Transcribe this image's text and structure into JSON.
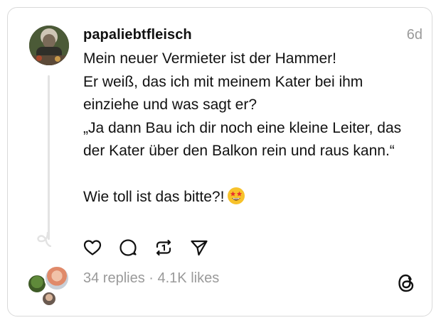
{
  "post": {
    "username": "papaliebtfleisch",
    "timestamp": "6d",
    "lines": [
      "Mein neuer Vermieter ist der Hammer!",
      "Er weiß, das ich mit meinem Kater bei ihm einziehe und was sagt er?",
      "„Ja dann Bau ich dir noch eine kleine Leiter, das der Kater über den Balkon rein und raus kann.“"
    ],
    "closing_line": "Wie toll ist das bitte?!",
    "closing_emoji": "star-struck-emoji"
  },
  "actions": {
    "like_icon": "heart-icon",
    "reply_icon": "comment-icon",
    "repost_icon": "repost-icon",
    "share_icon": "send-icon"
  },
  "stats": {
    "text": "34 replies · 4.1K likes"
  },
  "branding": {
    "logo_icon": "threads-logo-icon"
  },
  "colors": {
    "text": "#111111",
    "muted": "#9a9a9a",
    "border": "#d9d9d9",
    "thread_line": "#e3e3e3"
  }
}
